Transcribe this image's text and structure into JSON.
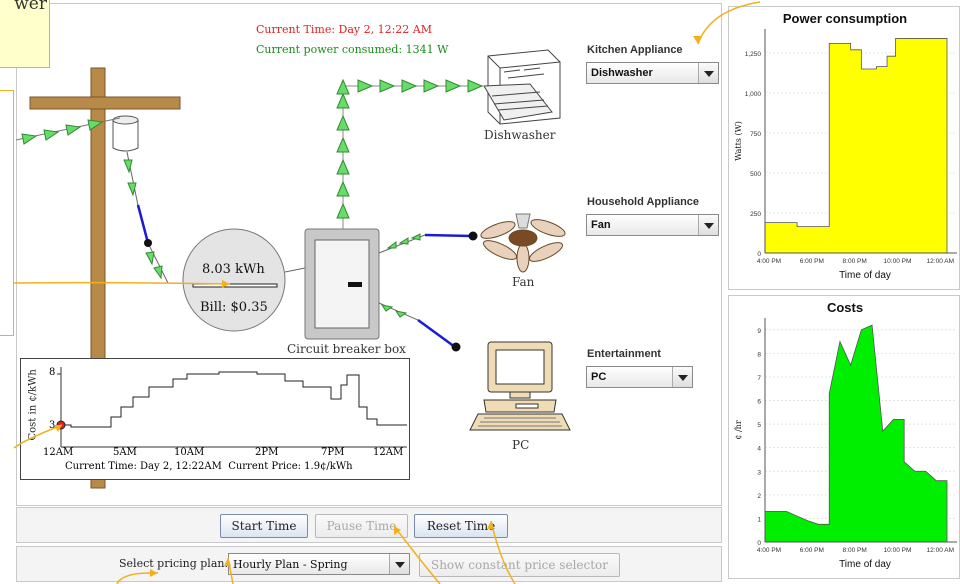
{
  "tooltip": {
    "text": "wer"
  },
  "status": {
    "current_time": "Current Time: Day 2, 12:22 AM",
    "current_power": "Current power consumed: 1341 W"
  },
  "meter": {
    "energy": "8.03 kWh",
    "bill": "Bill: $0.35"
  },
  "devices": {
    "dishwasher": "Dishwasher",
    "fan": "Fan",
    "pc": "PC",
    "breaker": "Circuit breaker box"
  },
  "selectors": {
    "kitchen": {
      "label": "Kitchen Appliance",
      "value": "Dishwasher"
    },
    "household": {
      "label": "Household Appliance",
      "value": "Fan"
    },
    "entertainment": {
      "label": "Entertainment",
      "value": "PC"
    }
  },
  "price_chart": {
    "ylabel": "Cost in ¢/kWh",
    "yticks": [
      "3",
      "8"
    ],
    "xticks": [
      "12AM",
      "5AM",
      "10AM",
      "2PM",
      "7PM",
      "12AM"
    ],
    "footer": "Current Time: Day 2, 12:22AM  Current Price: 1.9¢/kWh"
  },
  "chart_data": [
    {
      "type": "area",
      "title": "Power consumption",
      "xlabel": "Time of day",
      "ylabel": "Watts (W)",
      "color": "#ffff00",
      "x_ticks": [
        "4:00 PM",
        "6:00 PM",
        "8:00 PM",
        "10:00 PM",
        "12:00 AM"
      ],
      "y_ticks": [
        "0",
        "250",
        "500",
        "750",
        "1,000",
        "1,250"
      ],
      "ylim": [
        0,
        1400
      ],
      "x": [
        0,
        1.5,
        1.5,
        3,
        3,
        4,
        4,
        4.5,
        4.5,
        5.2,
        5.2,
        5.7,
        5.7,
        6.1,
        6.1,
        8.5
      ],
      "values": [
        190,
        190,
        165,
        165,
        1310,
        1310,
        1270,
        1270,
        1150,
        1150,
        1165,
        1165,
        1230,
        1230,
        1341,
        1341
      ]
    },
    {
      "type": "area",
      "title": "Costs",
      "xlabel": "Time of day",
      "ylabel": "¢ /hr",
      "color": "#00ee00",
      "x_ticks": [
        "4:00 PM",
        "6:00 PM",
        "8:00 PM",
        "10:00 PM",
        "12:00 AM"
      ],
      "y_ticks": [
        "0",
        "1",
        "2",
        "3",
        "4",
        "5",
        "6",
        "7",
        "8",
        "9"
      ],
      "ylim": [
        0,
        9.5
      ],
      "x": [
        0,
        1,
        1.5,
        2,
        2.5,
        3,
        3,
        3.5,
        4,
        4.5,
        5,
        5.5,
        6,
        6.5,
        6.5,
        7,
        7.5,
        8,
        8.5,
        8.5
      ],
      "values": [
        1.3,
        1.3,
        1.1,
        0.9,
        0.75,
        0.75,
        6.3,
        8.5,
        7.5,
        9.0,
        9.2,
        4.7,
        5.2,
        5.2,
        3.4,
        3.0,
        3.0,
        2.6,
        2.6,
        2.6
      ]
    }
  ],
  "controls": {
    "start": "Start Time",
    "pause": "Pause Time",
    "reset": "Reset Time",
    "pricing_label": "Select pricing plan:",
    "pricing_value": "Hourly Plan - Spring",
    "constant_price": "Show constant price selector"
  }
}
